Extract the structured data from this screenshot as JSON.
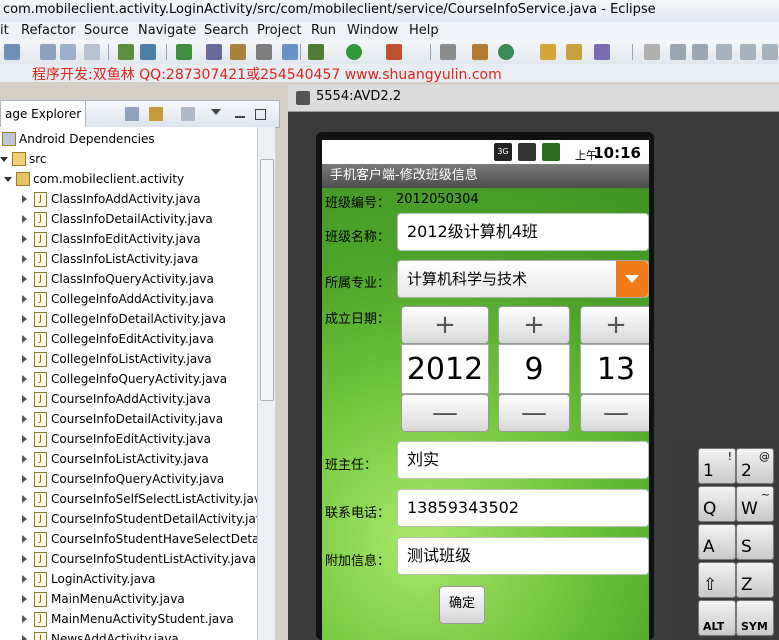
{
  "window": {
    "title": "com.mobileclient.activity.LoginActivity/src/com/mobileclient/service/CourseInfoService.java - Eclipse"
  },
  "menu": [
    "it",
    "Refactor",
    "Source",
    "Navigate",
    "Search",
    "Project",
    "Run",
    "Window",
    "Help"
  ],
  "promo": "程序开发:双鱼林 QQ:287307421或254540457 www.shuangyulin.com",
  "explorer": {
    "tab_label": "age Explorer",
    "rows": [
      {
        "label": "Android Dependencies",
        "kind": "lib",
        "indent": 0,
        "open": false
      },
      {
        "label": "src",
        "kind": "folder",
        "indent": 0,
        "open": true
      },
      {
        "label": "com.mobileclient.activity",
        "kind": "package",
        "indent": 1,
        "open": true
      },
      {
        "label": "ClassInfoAddActivity.java",
        "kind": "java",
        "indent": 2
      },
      {
        "label": "ClassInfoDetailActivity.java",
        "kind": "java",
        "indent": 2
      },
      {
        "label": "ClassInfoEditActivity.java",
        "kind": "java",
        "indent": 2
      },
      {
        "label": "ClassInfoListActivity.java",
        "kind": "java",
        "indent": 2
      },
      {
        "label": "ClassInfoQueryActivity.java",
        "kind": "java",
        "indent": 2
      },
      {
        "label": "CollegeInfoAddActivity.java",
        "kind": "java",
        "indent": 2
      },
      {
        "label": "CollegeInfoDetailActivity.java",
        "kind": "java",
        "indent": 2
      },
      {
        "label": "CollegeInfoEditActivity.java",
        "kind": "java",
        "indent": 2
      },
      {
        "label": "CollegeInfoListActivity.java",
        "kind": "java",
        "indent": 2
      },
      {
        "label": "CollegeInfoQueryActivity.java",
        "kind": "java",
        "indent": 2
      },
      {
        "label": "CourseInfoAddActivity.java",
        "kind": "java",
        "indent": 2
      },
      {
        "label": "CourseInfoDetailActivity.java",
        "kind": "java",
        "indent": 2
      },
      {
        "label": "CourseInfoEditActivity.java",
        "kind": "java",
        "indent": 2
      },
      {
        "label": "CourseInfoListActivity.java",
        "kind": "java",
        "indent": 2
      },
      {
        "label": "CourseInfoQueryActivity.java",
        "kind": "java",
        "indent": 2
      },
      {
        "label": "CourseInfoSelfSelectListActivity.java",
        "kind": "java",
        "indent": 2
      },
      {
        "label": "CourseInfoStudentDetailActivity.jav",
        "kind": "java",
        "indent": 2
      },
      {
        "label": "CourseInfoStudentHaveSelectDeta",
        "kind": "java",
        "indent": 2
      },
      {
        "label": "CourseInfoStudentListActivity.java",
        "kind": "java",
        "indent": 2
      },
      {
        "label": "LoginActivity.java",
        "kind": "java",
        "indent": 2
      },
      {
        "label": "MainMenuActivity.java",
        "kind": "java",
        "indent": 2
      },
      {
        "label": "MainMenuActivityStudent.java",
        "kind": "java",
        "indent": 2
      },
      {
        "label": "NewsAddActivity.java",
        "kind": "java",
        "indent": 2
      }
    ]
  },
  "emulator": {
    "title": "5554:AVD2.2",
    "status": {
      "ampm": "上午",
      "time": "10:16",
      "net": "3G"
    },
    "app_title": "手机客户端-修改班级信息",
    "form": {
      "class_no_label": "班级编号：",
      "class_no_value": "2012050304",
      "class_name_label": "班级名称：",
      "class_name_value": "2012级计算机4班",
      "major_label": "所属专业：",
      "major_value": "计算机科学与技术",
      "date_label": "成立日期：",
      "year": "2012",
      "month": "9",
      "day": "13",
      "plus": "+",
      "minus": "—",
      "teacher_label": "班主任：",
      "teacher_value": "刘实",
      "phone_label": "联系电话：",
      "phone_value": "13859343502",
      "extra_label": "附加信息：",
      "extra_value": "测试班级",
      "ok_label": "确定"
    },
    "keyboard": [
      {
        "main": "1",
        "alt": "!"
      },
      {
        "main": "2",
        "alt": "@"
      },
      {
        "main": "Q",
        "alt": ""
      },
      {
        "main": "W",
        "alt": "~"
      },
      {
        "main": "A",
        "alt": ""
      },
      {
        "main": "S",
        "alt": ""
      },
      {
        "main": "⇧",
        "alt": ""
      },
      {
        "main": "Z",
        "alt": ""
      },
      {
        "main": "ALT",
        "alt": ""
      },
      {
        "main": "SYM",
        "alt": ""
      }
    ]
  },
  "colors": {
    "promo": "#e2231a",
    "spinner_arrow": "#f07c1a",
    "screen_green": "#6fc33b"
  }
}
